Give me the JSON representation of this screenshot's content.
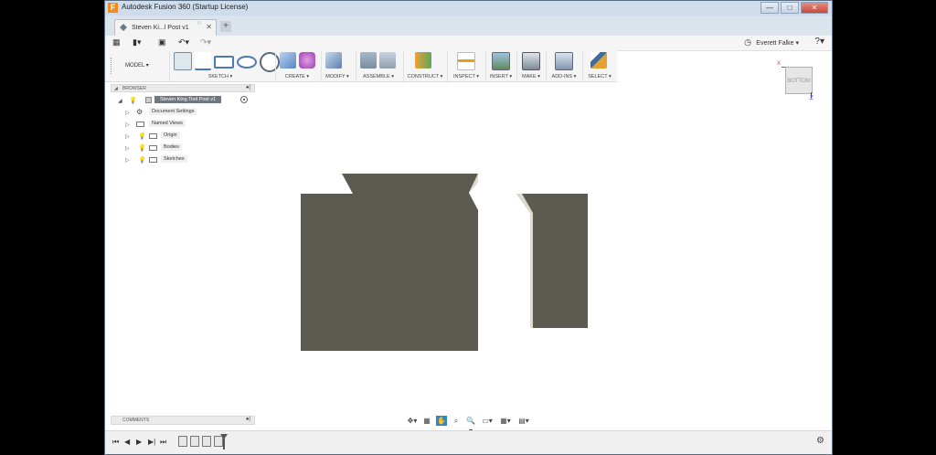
{
  "window": {
    "title": "Autodesk Fusion 360 (Startup License)",
    "minimize": "—",
    "maximize": "□",
    "close": "✕"
  },
  "tab": {
    "title": "Steven Ki...l Post v1",
    "close": "✕",
    "new": "+"
  },
  "quickbar": {
    "user": "Everett Falke ▾",
    "help": "?▾"
  },
  "toolbar": {
    "workspace": "MODEL ▾",
    "groups": {
      "sketch": "SKETCH ▾",
      "create": "CREATE ▾",
      "modify": "MODIFY ▾",
      "assemble": "ASSEMBLE ▾",
      "construct": "CONSTRUCT ▾",
      "inspect": "INSPECT ▾",
      "insert": "INSERT ▾",
      "make": "MAKE ▾",
      "addins": "ADD-INS ▾",
      "select": "SELECT ▾"
    }
  },
  "viewcube": {
    "face": "BOTTOM",
    "x_axis": "X",
    "z_axis": "Z"
  },
  "browser": {
    "header": "BROWSER",
    "root": "Steven King Tool Post v1",
    "items": [
      {
        "label": "Document Settings",
        "kind": "gear"
      },
      {
        "label": "Named Views",
        "kind": "folder"
      },
      {
        "label": "Origin",
        "kind": "folder-bulb"
      },
      {
        "label": "Bodies",
        "kind": "folder-bulb"
      },
      {
        "label": "Sketches",
        "kind": "folder-bulb"
      }
    ]
  },
  "comments": {
    "header": "COMMENTS"
  },
  "colors": {
    "body_fill": "#5d5a52",
    "body_edge": "#dedad0",
    "accent": "#2a87d6"
  }
}
